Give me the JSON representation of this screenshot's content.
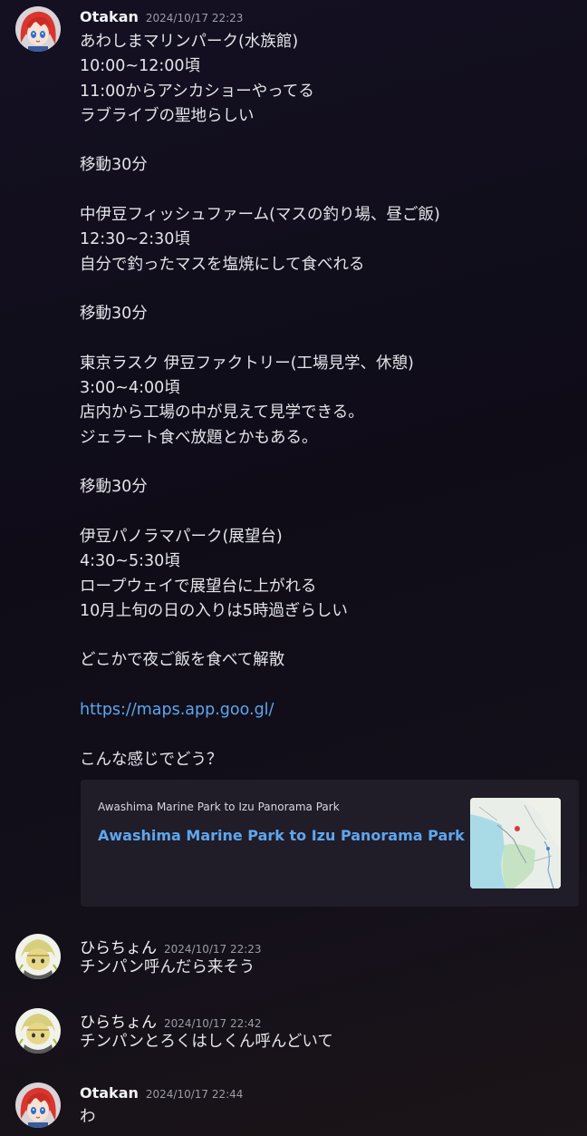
{
  "messages": [
    {
      "username": "Otakan",
      "timestamp": "2024/10/17 22:23",
      "lines": [
        "あわしまマリンパーク(水族館)",
        "10:00~12:00頃",
        "11:00からアシカショーやってる",
        "ラブライブの聖地らしい",
        "",
        "移動30分",
        "",
        "中伊豆フィッシュファーム(マスの釣り場、昼ご飯)",
        "12:30~2:30頃",
        "自分で釣ったマスを塩焼にして食べれる",
        "",
        "移動30分",
        "",
        "東京ラスク 伊豆ファクトリー(工場見学、休憩)",
        "3:00~4:00頃",
        "店内から工場の中が見えて見学できる。",
        "ジェラート食べ放題とかもある。",
        "",
        "移動30分",
        "",
        "伊豆パノラマパーク(展望台)",
        "4:30~5:30頃",
        "ロープウェイで展望台に上がれる",
        "10月上旬の日の入りは5時過ぎらしい",
        "",
        "どこかで夜ご飯を食べて解散",
        "",
        "https://maps.app.goo.gl/",
        "",
        "こんな感じでどう？"
      ],
      "embed": {
        "provider": "Awashima Marine Park to Izu Panorama Park",
        "title": "Awashima Marine Park to Izu Panorama Park"
      }
    },
    {
      "username": "ひらちょん",
      "timestamp": "2024/10/17 22:23",
      "text": "チンパン呼んだら来そう"
    },
    {
      "username": "ひらちょん",
      "timestamp": "2024/10/17 22:42",
      "text": "チンパンとろくはしくん呼んどいて"
    },
    {
      "username": "Otakan",
      "timestamp": "2024/10/17 22:44",
      "text": "わ"
    }
  ],
  "colors": {
    "link": "#5ea6ee",
    "background": "#110d1a",
    "embed_bg": "#201c28"
  }
}
